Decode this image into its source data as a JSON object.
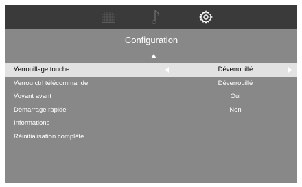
{
  "tabs": [
    {
      "icon": "picture-grid-icon",
      "active": false
    },
    {
      "icon": "music-note-icon",
      "active": false
    },
    {
      "icon": "gear-icon",
      "active": true
    }
  ],
  "menu": {
    "title": "Configuration",
    "items": [
      {
        "label": "Verrouillage touche",
        "value": "Déverrouillé",
        "selected": true
      },
      {
        "label": "Verrou ctrl télécommande",
        "value": "Déverrouillé",
        "selected": false
      },
      {
        "label": "Voyant avant",
        "value": "Oui",
        "selected": false
      },
      {
        "label": "Démarrage rapide",
        "value": "Non",
        "selected": false
      },
      {
        "label": "Informations",
        "value": "",
        "selected": false
      },
      {
        "label": "Réinitialisation complète",
        "value": "",
        "selected": false
      }
    ]
  },
  "colors": {
    "background": "#888888",
    "tabbar": "#3a3a3a",
    "selected_row": "#e2e2e2",
    "text": "#ffffff"
  }
}
